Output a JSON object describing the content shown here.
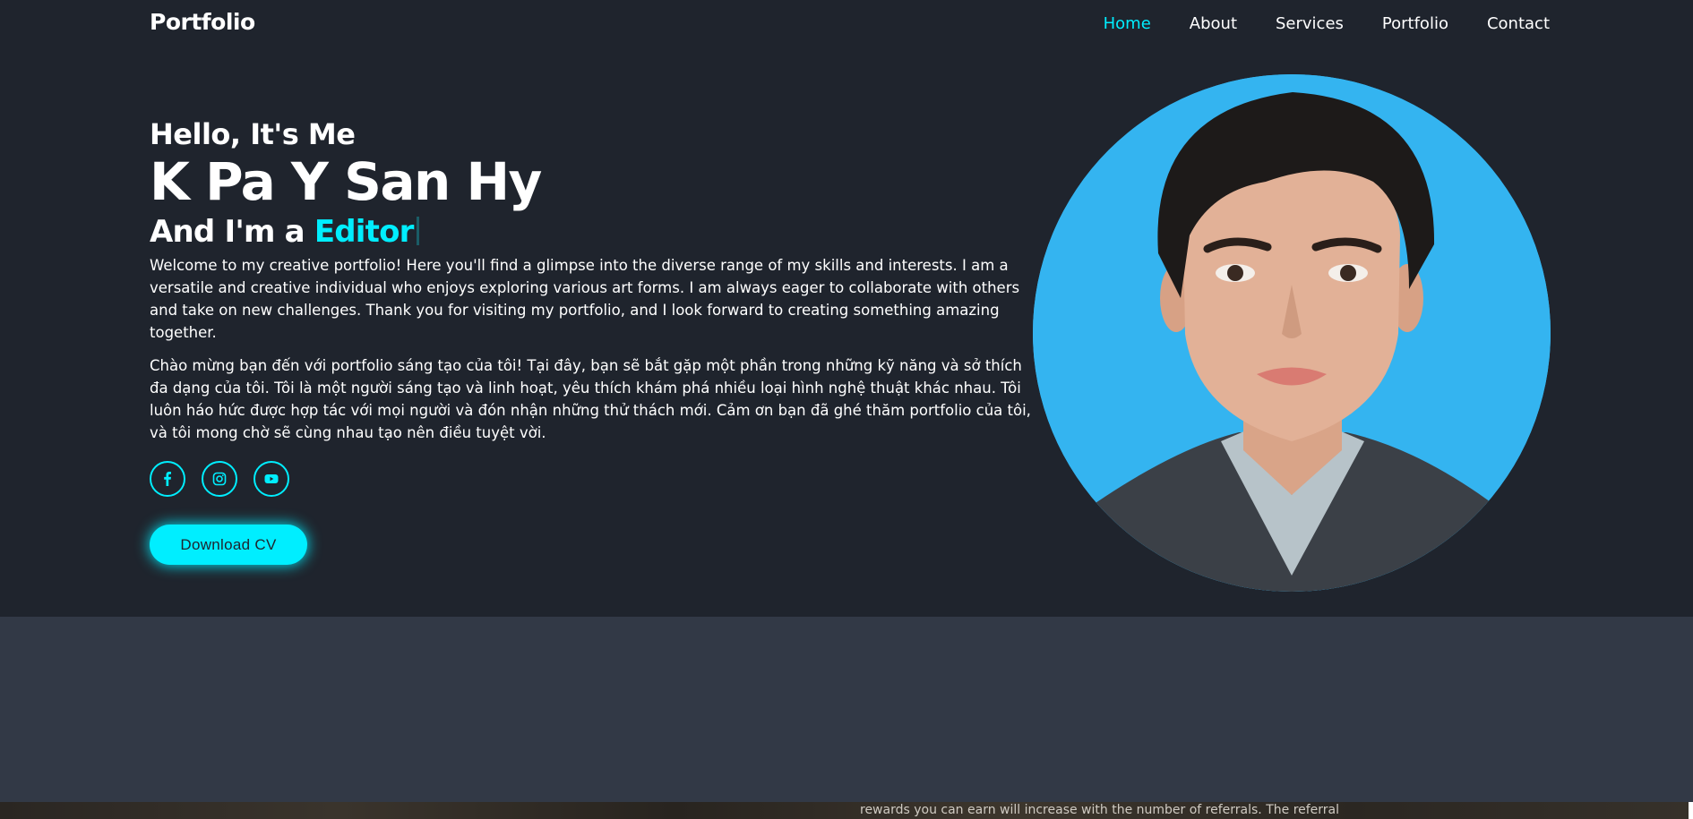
{
  "header": {
    "logo": "Portfolio",
    "nav": [
      "Home",
      "About",
      "Services",
      "Portfolio",
      "Contact"
    ],
    "active": "Home"
  },
  "hero": {
    "greeting": "Hello, It's Me",
    "name": "K Pa Y San Hy",
    "role_prefix": "And I'm a ",
    "role_highlight": "Editor",
    "intro_en": "Welcome to my creative portfolio! Here you'll find a glimpse into the diverse range of my skills and interests. I am a versatile and creative individual who enjoys exploring various art forms. I am always eager to collaborate with others and take on new challenges. Thank you for visiting my portfolio, and I look forward to creating something amazing together.",
    "intro_vi": "Chào mừng bạn đến với portfolio sáng tạo của tôi! Tại đây, bạn sẽ bắt gặp một phần trong những kỹ năng và sở thích đa dạng của tôi. Tôi là một người sáng tạo và linh hoạt, yêu thích khám phá nhiều loại hình nghệ thuật khác nhau. Tôi luôn háo hức được hợp tác với mọi người và đón nhận những thử thách mới. Cảm ơn bạn đã ghé thăm portfolio của tôi, và tôi mong chờ sẽ cùng nhau tạo nên điều tuyệt vời.",
    "socials": [
      "facebook-icon",
      "instagram-icon",
      "youtube-icon"
    ],
    "cv_button": "Download CV"
  },
  "bottom": {
    "partial_text": "rewards you can earn will increase with the number of referrals. The referral"
  },
  "colors": {
    "accent": "#00eeff",
    "background": "#1f242d",
    "section": "#323946",
    "avatar_bg": "#34b4f0"
  }
}
